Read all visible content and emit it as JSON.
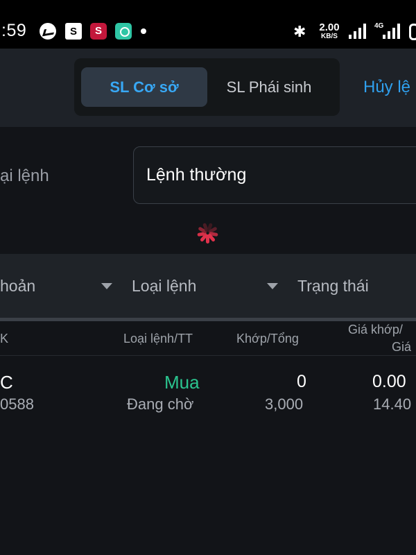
{
  "status_bar": {
    "time": ":59",
    "net_speed_value": "2.00",
    "net_speed_unit": "KB/S",
    "network_type": "4G",
    "icons": [
      "messenger-icon",
      "shopee-icon",
      "app-s-icon",
      "app-chat-icon",
      "notification-dot-icon",
      "bluetooth-icon",
      "signal-icon",
      "signal-icon",
      "battery-icon"
    ]
  },
  "header": {
    "tabs": [
      {
        "label": "SL Cơ sở",
        "active": true
      },
      {
        "label": "SL Phái sinh",
        "active": false
      }
    ],
    "cancel_label": "Hủy lệ"
  },
  "order_type": {
    "label": "ại lệnh",
    "selected": "Lệnh thường"
  },
  "filters": [
    {
      "label": "hoản"
    },
    {
      "label": "Loại lệnh"
    },
    {
      "label": "Trạng thái"
    }
  ],
  "table": {
    "columns": {
      "account": "K",
      "type_status": "Loại lệnh/TT",
      "matched_total": "Khớp/Tổng",
      "match_price_1": "Giá khớp/",
      "match_price_2": "Giá"
    },
    "rows": [
      {
        "symbol": "C",
        "account": "0588",
        "side": "Mua",
        "status": "Đang chờ",
        "matched": "0",
        "total": "3,000",
        "match_price": "0.00",
        "price": "14.40"
      }
    ]
  },
  "colors": {
    "accent_blue": "#38a8f5",
    "buy_green": "#2bc48f",
    "spinner_red": "#e0314b",
    "background": "#121418"
  }
}
